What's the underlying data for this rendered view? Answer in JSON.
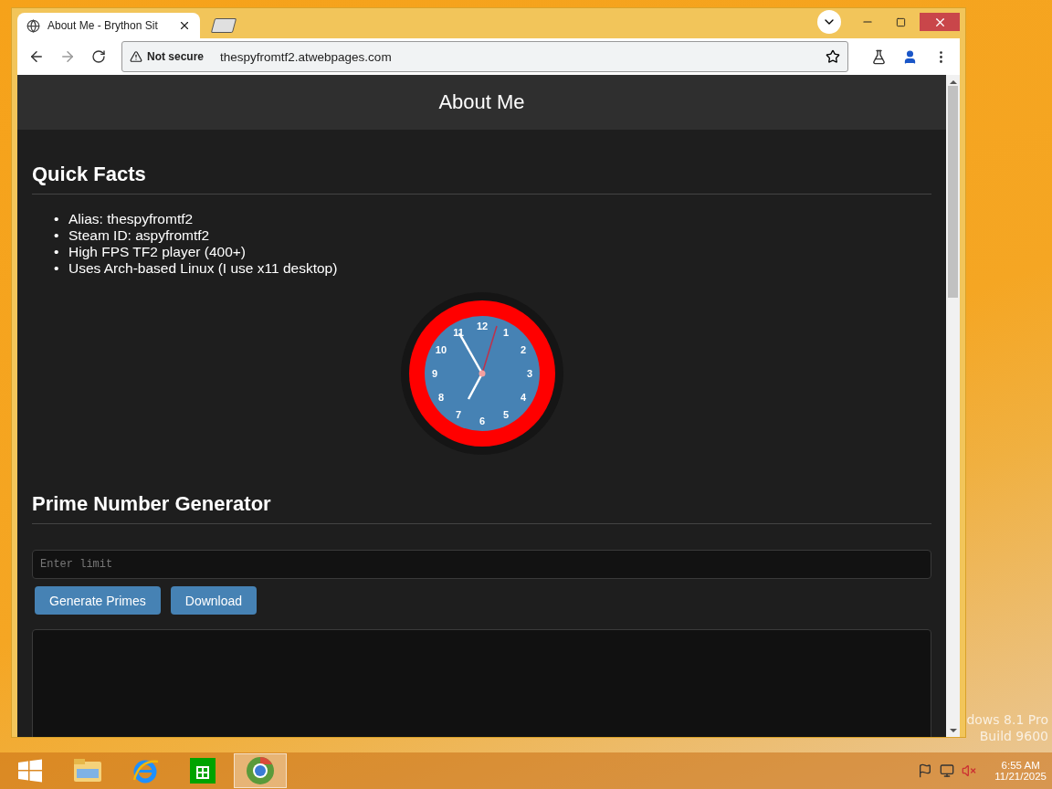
{
  "desktop_watermark": [
    "dows 8.1 Pro",
    "Build 9600"
  ],
  "browser": {
    "tab": {
      "title": "About Me - Brython Sit",
      "selected": true
    },
    "security": "Not secure",
    "url": "thespyfromtf2.atwebpages.com"
  },
  "page": {
    "header": "About Me",
    "sections": [
      {
        "kind": "facts",
        "heading": "Quick Facts",
        "bullet": "•",
        "items": [
          "Alias: thespyfromtf2",
          "Steam ID: aspyfromtf2",
          "High FPS TF2 player (400+)",
          "Uses Arch-based Linux (I use x11 desktop)"
        ],
        "clock": {
          "numerals": [
            "12",
            "1",
            "2",
            "3",
            "4",
            "5",
            "6",
            "7",
            "8",
            "9",
            "10",
            "11"
          ]
        }
      },
      {
        "kind": "primes",
        "heading": "Prime Number Generator",
        "input": {
          "placeholder": "Enter limit"
        },
        "buttons": [
          "Generate Primes",
          "Download"
        ]
      }
    ]
  },
  "taskbar": {
    "apps": [
      {
        "kind": "explorer",
        "selected": false
      },
      {
        "kind": "ie",
        "selected": false
      },
      {
        "kind": "store",
        "selected": false
      },
      {
        "kind": "chrome",
        "selected": true
      }
    ],
    "time": "6:55 AM",
    "date": "11/21/2025"
  }
}
